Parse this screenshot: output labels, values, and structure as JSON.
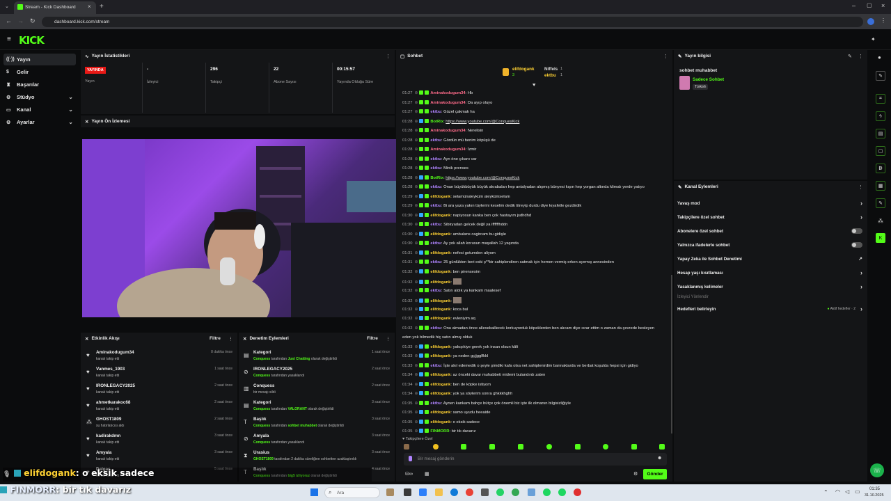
{
  "browser": {
    "tab_title": "Stream - Kick Dashboard",
    "url": "dashboard.kick.com/stream"
  },
  "app": {
    "logo": "KICK"
  },
  "sidebar": {
    "items": [
      {
        "label": "Yayın",
        "icon": "broadcast-icon"
      },
      {
        "label": "Gelir",
        "icon": "money-icon"
      },
      {
        "label": "Başarılar",
        "icon": "trophy-icon"
      },
      {
        "label": "Stüdyo",
        "icon": "studio-icon"
      },
      {
        "label": "Kanal",
        "icon": "channel-icon"
      },
      {
        "label": "Ayarlar",
        "icon": "gear-icon"
      }
    ]
  },
  "stats": {
    "title": "Yayın İstatistikleri",
    "live_badge": "YAYINDA",
    "items": [
      {
        "value": "",
        "label": "Yayın"
      },
      {
        "value": "-",
        "label": "İzleyici"
      },
      {
        "value": "296",
        "label": "Takipçi"
      },
      {
        "value": "22",
        "label": "Abone Sayısı"
      },
      {
        "value": "00:15:57",
        "label": "Yayında Olduğu Süre"
      }
    ]
  },
  "preview": {
    "title": "Yayın Ön İzlemesi"
  },
  "activity": {
    "title": "Etkinlik Akışı",
    "filter": "Filtre",
    "items": [
      {
        "name": "Aminakodugum34",
        "sub": "kanalı takip etti",
        "time": "8 dakika önce"
      },
      {
        "name": "Vanmes_1903",
        "sub": "kanalı takip etti",
        "time": "1 saat önce"
      },
      {
        "name": "IRONLEGACY2025",
        "sub": "kanalı takip etti",
        "time": "2 saat önce"
      },
      {
        "name": "ahmetkarakoc68",
        "sub": "kanalı takip etti",
        "time": "2 saat önce"
      },
      {
        "name": "GHOST1809",
        "sub": "su hatırlatıcısı aldı",
        "time": "2 saat önce"
      },
      {
        "name": "kadirakdmn",
        "sub": "kanalı takip etti",
        "time": "3 saat önce"
      },
      {
        "name": "Amyala",
        "sub": "kanalı takip etti",
        "time": "3 saat önce"
      },
      {
        "name": "Dalgaş",
        "sub": "kanalı takip etti",
        "time": "5 saat önce"
      }
    ]
  },
  "moderation": {
    "title": "Denetim Eylemleri",
    "filter": "Filtre",
    "items": [
      {
        "name": "Kategori",
        "actor": "Conquess",
        "mid": "tarafından",
        "hl": "Just Chatting",
        "rest": "olarak değiştirildi",
        "time": "1 saat önce"
      },
      {
        "name": "IRONLEGACY2025",
        "actor": "Conquess",
        "mid": "tarafından yasaklandı",
        "hl": "",
        "rest": "",
        "time": "2 saat önce"
      },
      {
        "name": "Conquess",
        "actor": "",
        "mid": "bir mesajı sildi",
        "hl": "",
        "rest": "",
        "time": "2 saat önce"
      },
      {
        "name": "Kategori",
        "actor": "Conquess",
        "mid": "tarafından",
        "hl": "VALORANT",
        "rest": "olarak değiştirildi",
        "time": "3 saat önce"
      },
      {
        "name": "Başlık",
        "actor": "Conquess",
        "mid": "tarafından",
        "hl": "sohbet muhabbet",
        "rest": "olarak değiştirildi",
        "time": "3 saat önce"
      },
      {
        "name": "Amyala",
        "actor": "Conquess",
        "mid": "tarafından yasaklandı",
        "hl": "",
        "rest": "",
        "time": "3 saat önce"
      },
      {
        "name": "Urasius",
        "actor": "GHOST1809",
        "mid": "tarafından 2 dakika süreliğine sohbetten uzaklaştırıldı",
        "hl": "",
        "rest": "",
        "time": "3 saat önce"
      },
      {
        "name": "Başlık",
        "actor": "Conquess",
        "mid": "tarafından",
        "hl": "big5 izliyoruz",
        "rest": "olarak değiştirildi",
        "time": "4 saat önce"
      }
    ]
  },
  "chat": {
    "title": "Sohbet",
    "pinned": [
      {
        "name": "elifdogank",
        "count": "3"
      },
      {
        "name": "Niffels",
        "count": "1"
      },
      {
        "name": "ektbu",
        "count": "1"
      }
    ],
    "messages": [
      {
        "time": "01:27",
        "user": "Aminakodugum34",
        "color": "#ff6b8a",
        "text": "Hb"
      },
      {
        "time": "01:27",
        "user": "Aminakodugum34",
        "color": "#ff6b8a",
        "text": "Da ayıp oluyo"
      },
      {
        "time": "01:27",
        "user": "ektbu",
        "color": "#b084ff",
        "text": "Güzel çakmak ha"
      },
      {
        "time": "01:28",
        "user": "BotRix",
        "color": "#53fc18",
        "text": "https://www.youtube.com/@ConquesKick"
      },
      {
        "time": "01:28",
        "user": "Aminakodugum34",
        "color": "#ff6b8a",
        "text": "Nerelisin"
      },
      {
        "time": "01:28",
        "user": "ektbu",
        "color": "#b084ff",
        "text": "Gördün mü benim köpüşü de"
      },
      {
        "time": "01:28",
        "user": "Aminakodugum34",
        "color": "#ff6b8a",
        "text": "İzmir"
      },
      {
        "time": "01:28",
        "user": "ektbu",
        "color": "#b084ff",
        "text": "Ayn öne çıkanı var"
      },
      {
        "time": "01:28",
        "user": "ektbu",
        "color": "#b084ff",
        "text": "Minik prenses"
      },
      {
        "time": "01:28",
        "user": "BotRix",
        "color": "#53fc18",
        "text": "https://www.youtube.com/@ConquesKick"
      },
      {
        "time": "01:28",
        "user": "ektbu",
        "color": "#b084ff",
        "text": "Onun büyükbüyük büyük akrabaları hep antalyadan alışmış bünyesi kışın hep yorgan altında klimalı yerde yatıyo"
      },
      {
        "time": "01:29",
        "user": "elifdogank",
        "color": "#ffd233",
        "text": "selamünaleyküm aleykümselam"
      },
      {
        "time": "01:29",
        "user": "ektbu",
        "color": "#b084ff",
        "text": "Bi ara yaza yakın tüylerini keselim dedik titreyip durdu diye kıyafetle gezdirdik"
      },
      {
        "time": "01:30",
        "user": "elifdogank",
        "color": "#ffd233",
        "text": "napiyosun kanka ben çok hastayım jsdhdhd"
      },
      {
        "time": "01:30",
        "user": "ektbu",
        "color": "#b084ff",
        "text": "Sibiryadan gelcek değil ya iffffffhddn"
      },
      {
        "time": "01:30",
        "user": "elifdogank",
        "color": "#ffd233",
        "text": "ambulans cagircam bu gidişle"
      },
      {
        "time": "01:30",
        "user": "ektbu",
        "color": "#b084ff",
        "text": "Ay yok allah korusun maşallah 12 yaşında"
      },
      {
        "time": "01:31",
        "user": "elifdogank",
        "color": "#ffd233",
        "text": "nefesi gotumden aliyom"
      },
      {
        "time": "01:31",
        "user": "ektbu",
        "color": "#b084ff",
        "text": "25 günlükten beri eski ş**bir sahiplendiren satmak için hemen vermiş erken ayırmış annesinden"
      },
      {
        "time": "01:32",
        "user": "elifdogank",
        "color": "#ffd233",
        "text": "ben pirensesim"
      },
      {
        "time": "01:32",
        "user": "elifdogank",
        "color": "#ffd233",
        "text": ""
      },
      {
        "time": "01:32",
        "user": "ektbu",
        "color": "#b084ff",
        "text": "Satın aldık ya kankam maalesef"
      },
      {
        "time": "01:32",
        "user": "elifdogank",
        "color": "#ffd233",
        "text": ""
      },
      {
        "time": "01:32",
        "user": "elifdogank",
        "color": "#ffd233",
        "text": "koca bul"
      },
      {
        "time": "01:32",
        "user": "elifdogank",
        "color": "#ffd233",
        "text": "evleniyim aq"
      },
      {
        "time": "01:32",
        "user": "ektbu",
        "color": "#b084ff",
        "text": "Onu almadan önce allexekaillecek korkuyorduk köpeklerden ben alıcam diye ısrar ettim o zaman da çevrede besleyen"
      },
      {
        "time": "",
        "user": "",
        "color": "#e8e8e8",
        "text": "eden yok bilmedik hiç satın almış olduk"
      },
      {
        "time": "01:33",
        "user": "elifdogank",
        "color": "#ffd233",
        "text": "yakışıkiye gerek yok insan olsun kâfi"
      },
      {
        "time": "01:33",
        "user": "elifdogank",
        "color": "#ffd233",
        "text": "ya neden gçjjgglfkkl"
      },
      {
        "time": "01:33",
        "user": "ektbu",
        "color": "#b084ff",
        "text": "İşte akıl edemedik o şeyle şimdiki kafa olsa net sahiplenirdim bannaklarda ve berbat koşulda hepsi için gidiyo"
      },
      {
        "time": "01:34",
        "user": "elifdogank",
        "color": "#ffd233",
        "text": "az önceki davar muhabbeti midemi bulandırdı zaten"
      },
      {
        "time": "01:34",
        "user": "elifdogank",
        "color": "#ffd233",
        "text": "ben de köpke istiyom"
      },
      {
        "time": "01:34",
        "user": "elifdogank",
        "color": "#ffd233",
        "text": "yok ya söylerim sonra ghkkkhghh"
      },
      {
        "time": "01:35",
        "user": "ektbu",
        "color": "#b084ff",
        "text": "Aynen kankam bahçe bütçe çok önemli biz işte ilk olmanın bilgisizliğiyle"
      },
      {
        "time": "01:35",
        "user": "elifdogank",
        "color": "#ffd233",
        "text": "samo uyudu heeaide"
      },
      {
        "time": "01:35",
        "user": "elifdogank",
        "color": "#ffd233",
        "text": "o eksik sadece"
      },
      {
        "time": "01:35",
        "user": "FINMORR",
        "color": "#53fc18",
        "text": "bir tık davarız"
      }
    ],
    "followers_only": "Takipçilere Özel",
    "input_placeholder": "Bir mesaj gönderin",
    "send_label": "Gönder"
  },
  "stream_info": {
    "title": "Yayın bilgisi",
    "stream_title": "sohbet muhabbet",
    "category": "Sadece Sohbet",
    "language": "Türkish"
  },
  "channel_actions": {
    "title": "Kanal Eylemleri",
    "items": [
      {
        "label": "Yavaş mod",
        "kind": "arrow"
      },
      {
        "label": "Takipçilere özel sohbet",
        "kind": "arrow"
      },
      {
        "label": "Abonelere özel sohbet",
        "kind": "toggle"
      },
      {
        "label": "Yalnızca ifadelerle sohbet",
        "kind": "toggle"
      },
      {
        "label": "Yapay Zeka ile Sohbet Denetimi",
        "kind": "ext"
      },
      {
        "label": "Hesap yaşı kısıtlaması",
        "kind": "arrow"
      },
      {
        "label": "Yasaklanmış kelimeler",
        "kind": "arrow"
      }
    ],
    "viewer_section": "İzleyici Yönlendir",
    "goals_label": "Hedefleri belirleyin",
    "goals_status": "Aktif hedefler · 2"
  },
  "overlay": {
    "line1_user": "elifdogank",
    "line1_text": ": o eksik sadece",
    "line2_user": "FINMORR",
    "line2_text": ": bir tık davarız"
  },
  "taskbar": {
    "search": "Ara",
    "time": "01:35",
    "date": "31.10.2025"
  }
}
